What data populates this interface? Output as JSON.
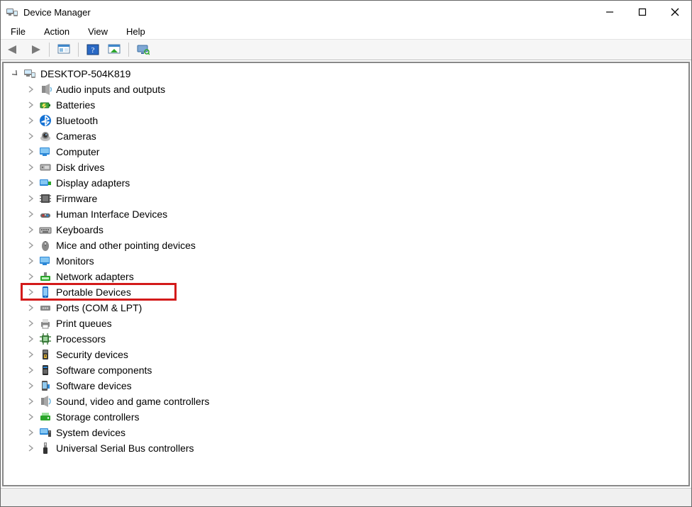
{
  "window": {
    "title": "Device Manager"
  },
  "menu": {
    "file": "File",
    "action": "Action",
    "view": "View",
    "help": "Help"
  },
  "toolbar": {
    "back": "back-icon",
    "forward": "forward-icon",
    "showhide": "show-hide-console-tree-icon",
    "help": "help-icon",
    "scan": "scan-hardware-icon",
    "monitor": "monitor-icon"
  },
  "tree": {
    "root": "DESKTOP-504K819",
    "nodes": [
      {
        "label": "Audio inputs and outputs",
        "icon": "speaker-icon"
      },
      {
        "label": "Batteries",
        "icon": "battery-icon"
      },
      {
        "label": "Bluetooth",
        "icon": "bluetooth-icon"
      },
      {
        "label": "Cameras",
        "icon": "camera-icon"
      },
      {
        "label": "Computer",
        "icon": "monitor-icon"
      },
      {
        "label": "Disk drives",
        "icon": "disk-icon"
      },
      {
        "label": "Display adapters",
        "icon": "display-adapter-icon"
      },
      {
        "label": "Firmware",
        "icon": "firmware-icon"
      },
      {
        "label": "Human Interface Devices",
        "icon": "hid-icon"
      },
      {
        "label": "Keyboards",
        "icon": "keyboard-icon"
      },
      {
        "label": "Mice and other pointing devices",
        "icon": "mouse-icon"
      },
      {
        "label": "Monitors",
        "icon": "monitor-icon"
      },
      {
        "label": "Network adapters",
        "icon": "network-adapter-icon"
      },
      {
        "label": "Portable Devices",
        "icon": "portable-device-icon",
        "highlighted": true
      },
      {
        "label": "Ports (COM & LPT)",
        "icon": "port-icon"
      },
      {
        "label": "Print queues",
        "icon": "printer-icon"
      },
      {
        "label": "Processors",
        "icon": "cpu-icon"
      },
      {
        "label": "Security devices",
        "icon": "security-icon"
      },
      {
        "label": "Software components",
        "icon": "software-component-icon"
      },
      {
        "label": "Software devices",
        "icon": "software-device-icon"
      },
      {
        "label": "Sound, video and game controllers",
        "icon": "sound-icon"
      },
      {
        "label": "Storage controllers",
        "icon": "storage-controller-icon"
      },
      {
        "label": "System devices",
        "icon": "system-device-icon"
      },
      {
        "label": "Universal Serial Bus controllers",
        "icon": "usb-icon"
      }
    ]
  },
  "colors": {
    "highlight": "#d31a1a"
  }
}
